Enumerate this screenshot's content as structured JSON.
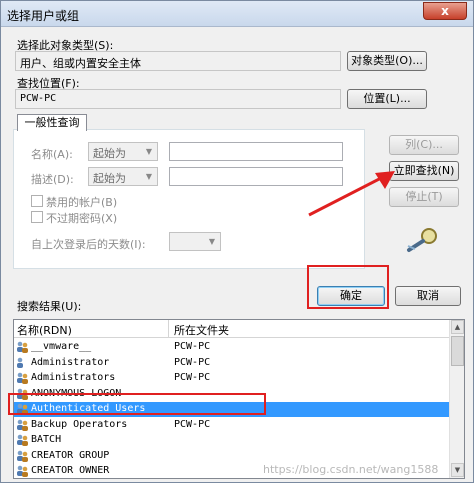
{
  "window": {
    "title": "选择用户或组",
    "close_label": "x"
  },
  "object_type": {
    "label": "选择此对象类型(S):",
    "value": "用户、组或内置安全主体",
    "button": "对象类型(O)..."
  },
  "location": {
    "label": "查找位置(F):",
    "value": "PCW-PC",
    "button": "位置(L)..."
  },
  "query": {
    "tab": "一般性查询",
    "name_label": "名称(A):",
    "name_mode": "起始为",
    "desc_label": "描述(D):",
    "desc_mode": "起始为",
    "disabled_accounts": "禁用的帐户(B)",
    "no_expire_pwd": "不过期密码(X)",
    "days_label": "自上次登录后的天数(I):",
    "btn_columns": "列(C)...",
    "btn_find_now": "立即查找(N)",
    "btn_stop": "停止(T)"
  },
  "actions": {
    "ok": "确定",
    "cancel": "取消"
  },
  "results": {
    "label": "搜索结果(U):",
    "col_name": "名称(RDN)",
    "col_folder": "所在文件夹",
    "rows": [
      {
        "name": "__vmware__",
        "folder": "PCW-PC"
      },
      {
        "name": "Administrator",
        "folder": "PCW-PC"
      },
      {
        "name": "Administrators",
        "folder": "PCW-PC"
      },
      {
        "name": "ANONYMOUS LOGON",
        "folder": ""
      },
      {
        "name": "Authenticated Users",
        "folder": ""
      },
      {
        "name": "Backup Operators",
        "folder": "PCW-PC"
      },
      {
        "name": "BATCH",
        "folder": ""
      },
      {
        "name": "CREATOR GROUP",
        "folder": ""
      },
      {
        "name": "CREATOR OWNER",
        "folder": ""
      }
    ]
  },
  "watermark": "https://blog.csdn.net/wang1588",
  "colors": {
    "highlight_red": "#e02020",
    "selection": "#3399ff",
    "arrow_red": "#e02020"
  }
}
